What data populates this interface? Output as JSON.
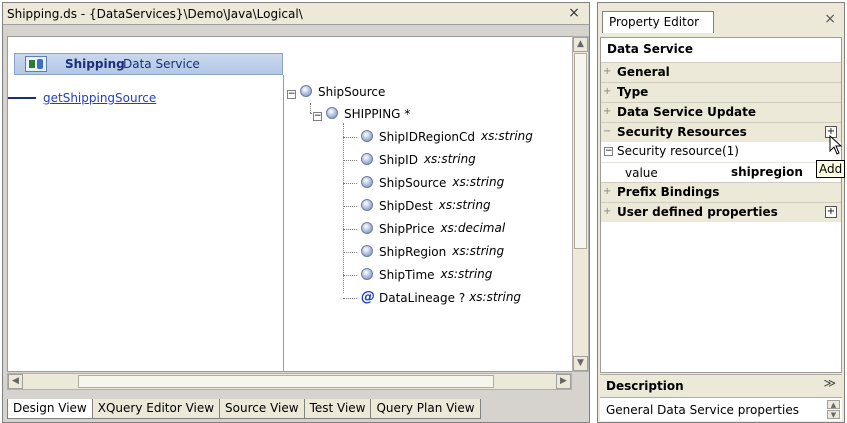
{
  "editor": {
    "title": "Shipping.ds - {DataServices}\\Demo\\Java\\Logical\\",
    "close_glyph": "×",
    "data_service": {
      "name": "Shipping",
      "type_label": "Data Service",
      "icon": "data-service-icon"
    },
    "function_link": "getShippingSource",
    "tree": {
      "root": "ShipSource",
      "element": "SHIPPING *",
      "fields": [
        {
          "name": "ShipIDRegionCd",
          "type": "xs:string"
        },
        {
          "name": "ShipID",
          "type": "xs:string"
        },
        {
          "name": "ShipSource",
          "type": "xs:string"
        },
        {
          "name": "ShipDest",
          "type": "xs:string"
        },
        {
          "name": "ShipPrice",
          "type": "xs:decimal"
        },
        {
          "name": "ShipRegion",
          "type": "xs:string"
        },
        {
          "name": "ShipTime",
          "type": "xs:string"
        }
      ],
      "attribute": {
        "name": "DataLineage ?",
        "type": "xs:string",
        "icon": "at-icon"
      }
    },
    "tabs": [
      {
        "label": "Design View",
        "active": true
      },
      {
        "label": "XQuery Editor View",
        "active": false
      },
      {
        "label": "Source View",
        "active": false
      },
      {
        "label": "Test View",
        "active": false
      },
      {
        "label": "Query Plan View",
        "active": false
      }
    ]
  },
  "property_editor": {
    "tab_label": "Property Editor",
    "close_glyph": "×",
    "heading": "Data Service",
    "sections": [
      {
        "name": "General",
        "expanded": false
      },
      {
        "name": "Type",
        "expanded": false
      },
      {
        "name": "Data Service Update",
        "expanded": false
      },
      {
        "name": "Security Resources",
        "expanded": true
      },
      {
        "name": "Prefix Bindings",
        "expanded": false
      },
      {
        "name": "User defined properties",
        "expanded": false
      }
    ],
    "security_resource": {
      "label": "Security resource(1)",
      "key": "value",
      "value": "shipregion"
    },
    "tooltip": "Add",
    "description": {
      "title": "Description",
      "text": "General Data Service properties"
    }
  },
  "colors": {
    "header_blue": "#1a2e7a",
    "link_blue": "#1f3fc7",
    "panel_gray": "#ece9d8"
  }
}
